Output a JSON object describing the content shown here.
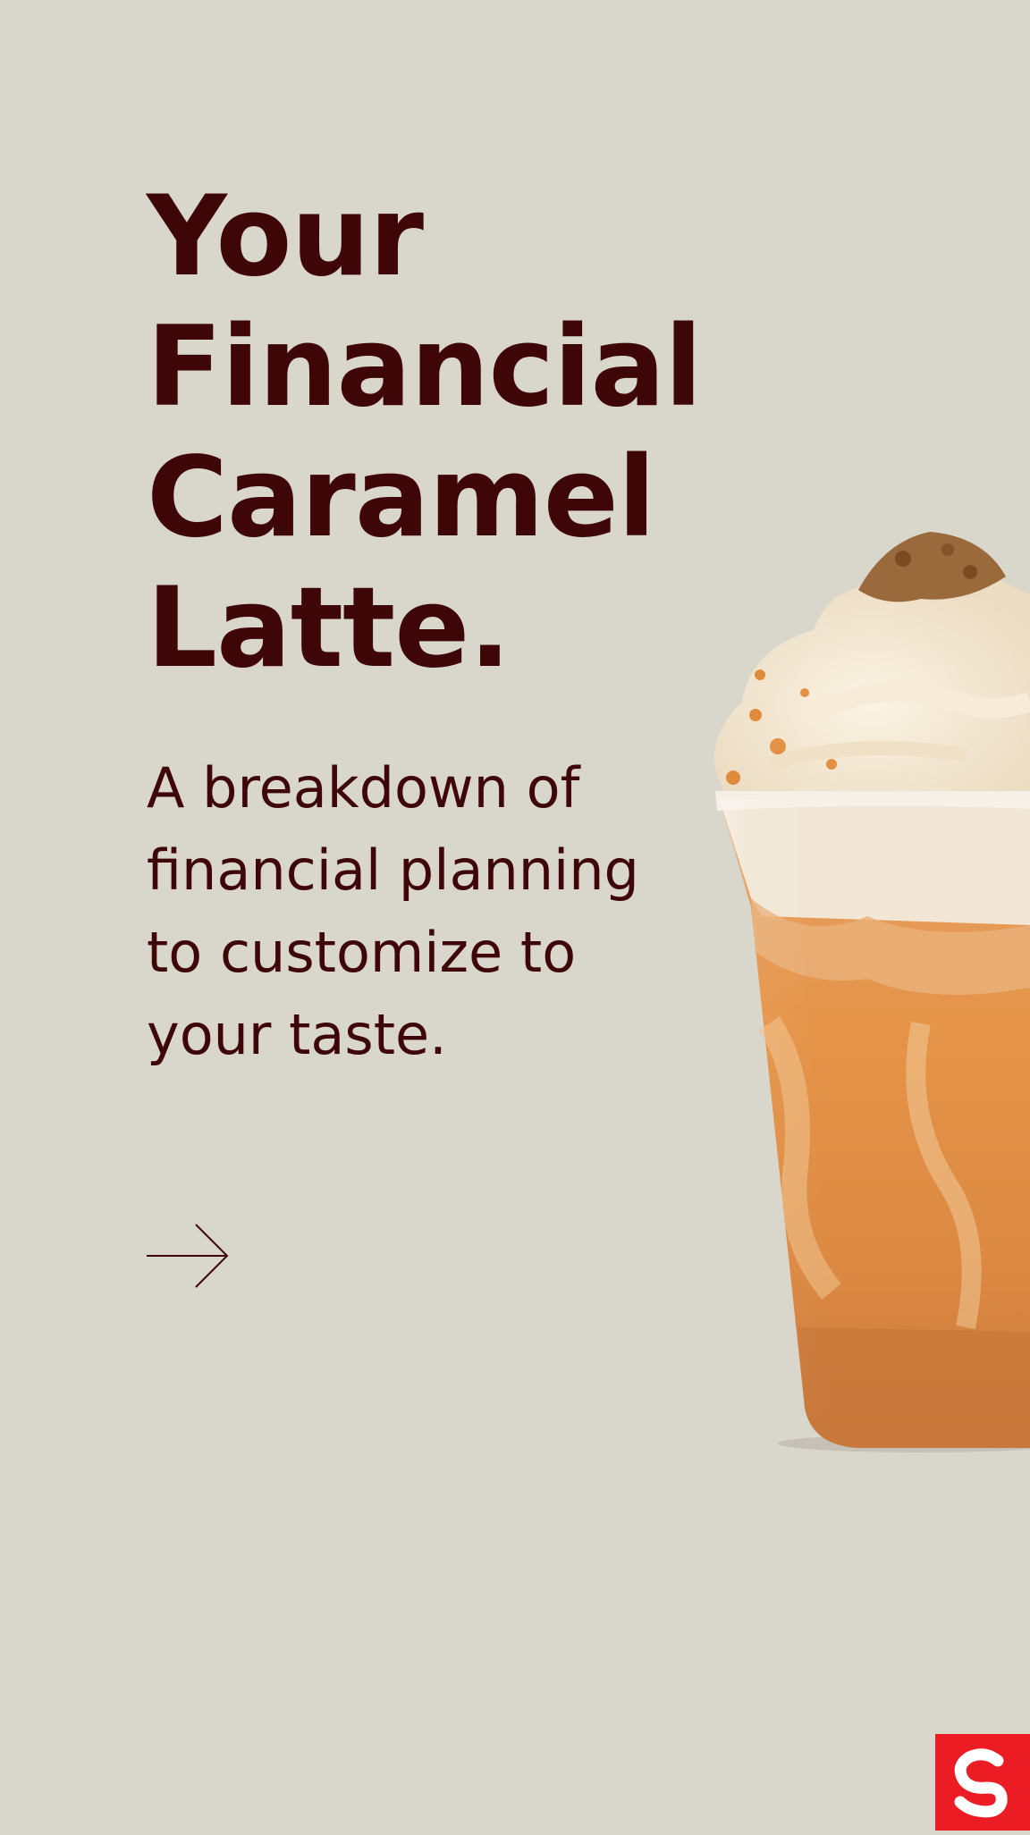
{
  "headline": {
    "lines": [
      "Your",
      "Financial",
      "Caramel",
      "Latte."
    ]
  },
  "subhead": {
    "lines": [
      "A breakdown of",
      "financial planning",
      "to customize to",
      "your taste."
    ]
  },
  "arrow": {
    "icon": "arrow-right-icon"
  },
  "drink": {
    "icon": "caramel-latte-image"
  },
  "brand": {
    "icon": "scotiabank-logo",
    "color": "#EC1C24"
  },
  "colors": {
    "background": "#D9D6CC",
    "text": "#3F0608"
  }
}
